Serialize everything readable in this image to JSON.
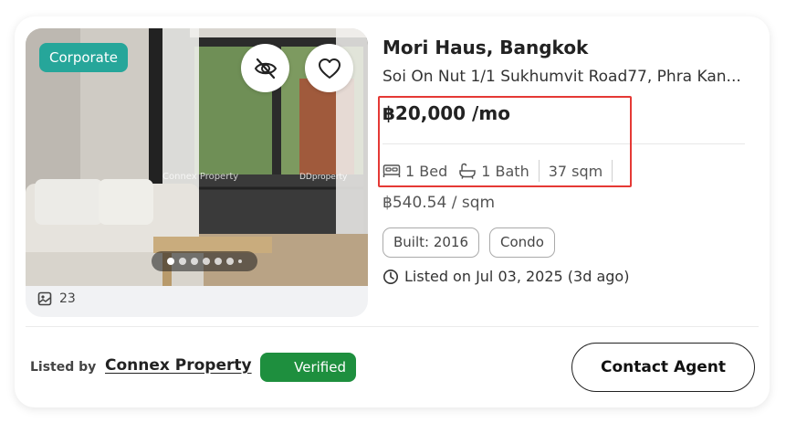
{
  "listing": {
    "badge": "Corporate",
    "photo_count": "23",
    "photo_watermark_left": "Connex Property",
    "photo_watermark_right": "DDproperty",
    "title": "Mori Haus, Bangkok",
    "address": "Soi On Nut 1/1 Sukhumvit Road77, Phra Kan...",
    "price": "฿20,000 /mo",
    "beds": "1 Bed",
    "baths": "1 Bath",
    "area": "37 sqm",
    "price_per_sqm": "฿540.54 / sqm",
    "tags": [
      "Built: 2016",
      "Condo"
    ],
    "listed_on": "Listed on Jul 03, 2025 (3d ago)",
    "carousel": {
      "total_dots": 7,
      "active_index": 0
    }
  },
  "footer": {
    "listed_by_label": "Listed by",
    "agency_name": "Connex Property",
    "verified_label": "Verified",
    "contact_label": "Contact Agent"
  },
  "icons": {
    "hide": "eye-slash-icon",
    "favorite": "heart-icon",
    "bed": "bed-icon",
    "bath": "bathtub-icon",
    "clock": "clock-icon",
    "gallery": "image-icon"
  },
  "colors": {
    "badge": "#26a69a",
    "verified": "#1e8f3e",
    "highlight": "#e53935"
  }
}
